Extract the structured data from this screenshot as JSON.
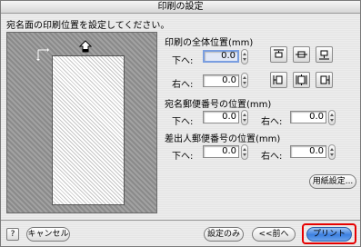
{
  "window": {
    "title": "印刷の設定"
  },
  "instruction": "宛名面の印刷位置を設定してください。",
  "overall_position": {
    "title": "印刷の全体位置(mm)",
    "down_label": "下へ:",
    "down_value": "0.0",
    "right_label": "右へ:",
    "right_value": "0.0"
  },
  "recipient_postal": {
    "title": "宛名郵便番号の位置(mm)",
    "down_label": "下へ:",
    "down_value": "0.0",
    "right_label": "右へ:",
    "right_value": "0.0"
  },
  "sender_postal": {
    "title": "差出人郵便番号の位置(mm)",
    "down_label": "下へ:",
    "down_value": "0.0",
    "right_label": "右へ:",
    "right_value": "0.0"
  },
  "buttons": {
    "paper_settings": "用紙設定...",
    "help": "?",
    "cancel": "キャンセル",
    "settings_only": "設定のみ",
    "back": "<<前へ",
    "print": "プリント"
  },
  "colors": {
    "primary_button": "#3b7fe0",
    "highlight_ring": "#e60000"
  }
}
